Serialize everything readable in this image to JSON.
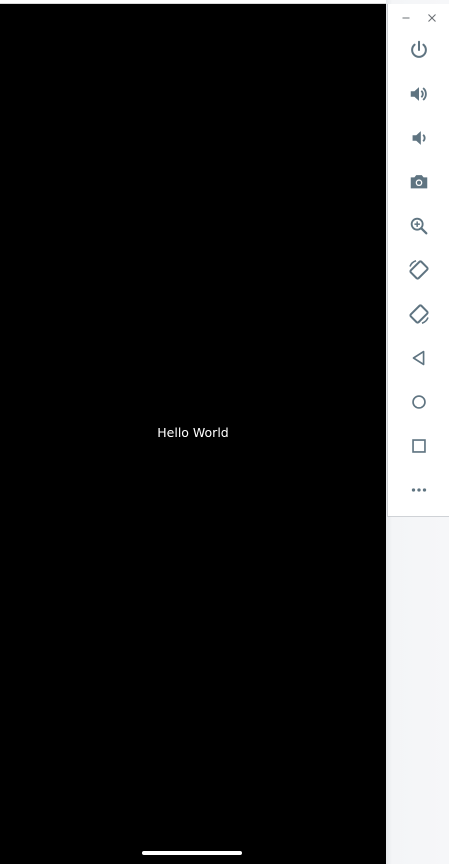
{
  "app": {
    "screen_text": "Hello World"
  },
  "toolbar": {
    "icon_color": "#5f7481",
    "window_controls": [
      {
        "name": "minimize",
        "glyph": "−"
      },
      {
        "name": "close",
        "glyph": "×"
      }
    ],
    "buttons": [
      {
        "name": "power",
        "icon": "power-icon"
      },
      {
        "name": "volume-up",
        "icon": "volume-up-icon"
      },
      {
        "name": "volume-down",
        "icon": "volume-down-icon"
      },
      {
        "name": "screenshot",
        "icon": "camera-icon"
      },
      {
        "name": "zoom",
        "icon": "zoom-in-icon"
      },
      {
        "name": "rotate-left",
        "icon": "rotate-left-icon"
      },
      {
        "name": "rotate-right",
        "icon": "rotate-right-icon"
      },
      {
        "name": "back",
        "icon": "back-triangle-icon"
      },
      {
        "name": "home",
        "icon": "home-circle-icon"
      },
      {
        "name": "overview",
        "icon": "overview-square-icon"
      },
      {
        "name": "more",
        "icon": "more-horizontal-icon"
      }
    ]
  }
}
